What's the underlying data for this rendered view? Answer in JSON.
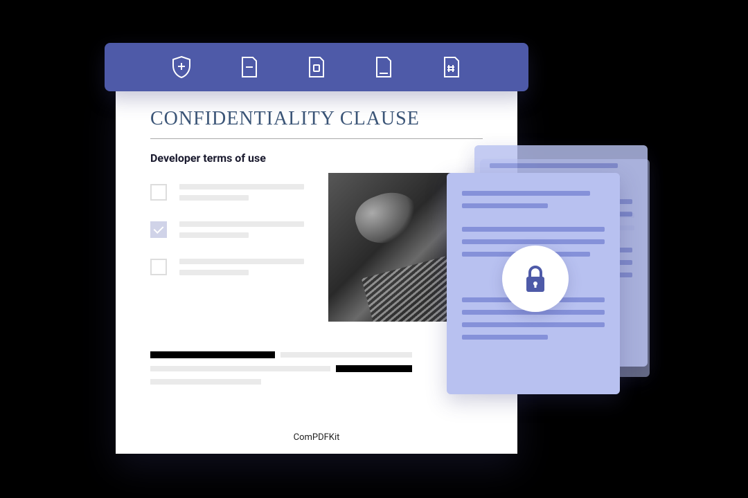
{
  "toolbar": {
    "icons": [
      "shield-plus",
      "page-minus",
      "page-letter",
      "page-bottom",
      "page-hash"
    ]
  },
  "document": {
    "title": "CONFIDENTIALITY CLAUSE",
    "subtitle": "Developer terms of use",
    "brand": "ComPDFKit"
  },
  "locked_overlay": {
    "icon": "lock"
  }
}
